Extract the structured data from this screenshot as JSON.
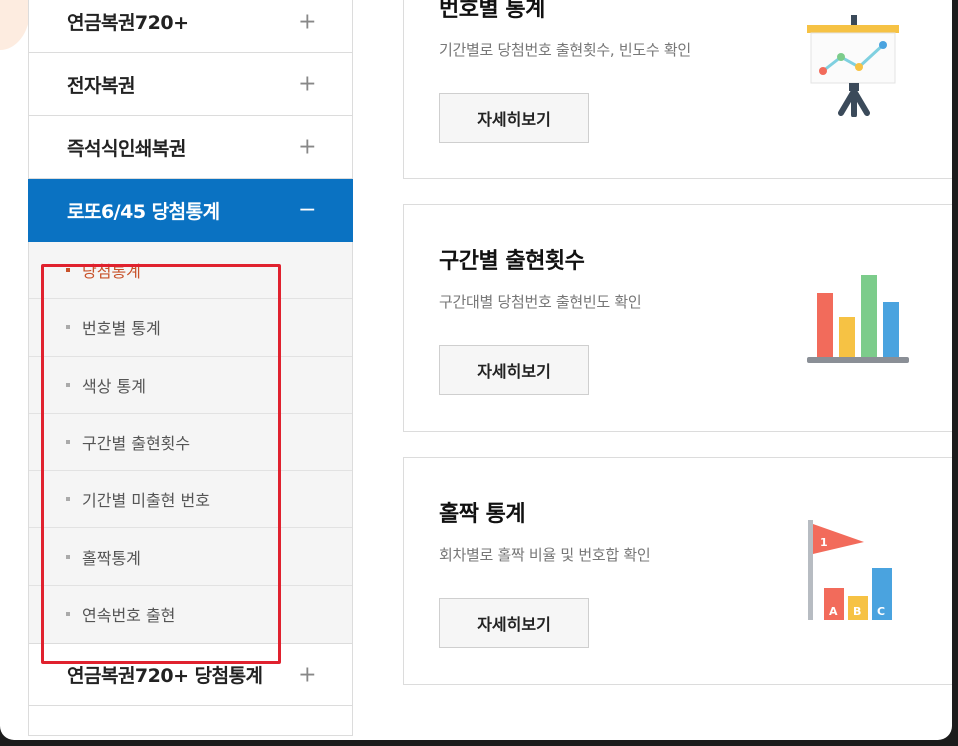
{
  "sidebar": {
    "items": [
      {
        "label": "연금복권720+",
        "toggle": "+"
      },
      {
        "label": "전자복권",
        "toggle": "+"
      },
      {
        "label": "즉석식인쇄복권",
        "toggle": "+"
      },
      {
        "label": "로또6/45 당첨통계",
        "toggle": "−"
      }
    ],
    "submenu": [
      {
        "label": "당첨통계"
      },
      {
        "label": "번호별 통계"
      },
      {
        "label": "색상 통계"
      },
      {
        "label": "구간별 출현횟수"
      },
      {
        "label": "기간별 미출현 번호"
      },
      {
        "label": "홀짝통계"
      },
      {
        "label": "연속번호 출현"
      }
    ],
    "after": [
      {
        "label": "연금복권720+ 당첨통계",
        "toggle": "+"
      }
    ]
  },
  "cards": [
    {
      "title": "번호별 통계",
      "desc": "기간별로 당첨번호 출현횟수, 빈도수 확인",
      "button": "자세히보기",
      "icon": "presentation-chart-icon"
    },
    {
      "title": "구간별 출현횟수",
      "desc": "구간대별 당첨번호 출현빈도 확인",
      "button": "자세히보기",
      "icon": "bar-chart-icon"
    },
    {
      "title": "홀짝 통계",
      "desc": "회차별로 홀짝 비율 및 번호합 확인",
      "button": "자세히보기",
      "icon": "flag-abc-icon"
    }
  ],
  "icon_text": {
    "flag_number": "1",
    "abc": [
      "A",
      "B",
      "C"
    ]
  },
  "colors": {
    "active_menu": "#0a72c2",
    "current_sub": "#c8522a",
    "highlight": "#e0212e"
  }
}
